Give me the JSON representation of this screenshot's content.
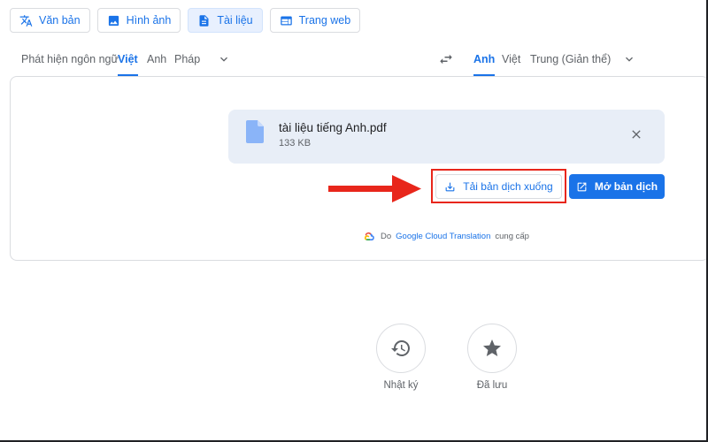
{
  "modes": [
    {
      "label": "Văn bản",
      "icon": "translate-icon"
    },
    {
      "label": "Hình ảnh",
      "icon": "image-icon"
    },
    {
      "label": "Tài liệu",
      "icon": "document-icon"
    },
    {
      "label": "Trang web",
      "icon": "web-icon"
    }
  ],
  "source_langs": [
    "Phát hiện ngôn ngữ",
    "Việt",
    "Anh",
    "Pháp"
  ],
  "source_active": "Việt",
  "target_langs": [
    "Anh",
    "Việt",
    "Trung (Giản thể)"
  ],
  "target_active": "Anh",
  "file": {
    "name": "tài liệu tiếng Anh.pdf",
    "size": "133 KB"
  },
  "buttons": {
    "download": "Tải bản dịch xuống",
    "open": "Mở bản dịch"
  },
  "powered": {
    "prefix": "Do",
    "link": "Google Cloud Translation",
    "suffix": "cung cấp"
  },
  "shortcuts": [
    {
      "label": "Nhật ký",
      "icon": "history-icon"
    },
    {
      "label": "Đã lưu",
      "icon": "star-icon"
    }
  ],
  "colors": {
    "accent": "#1a73e8",
    "highlight": "#e8261b",
    "file_card": "#e8eef7"
  }
}
